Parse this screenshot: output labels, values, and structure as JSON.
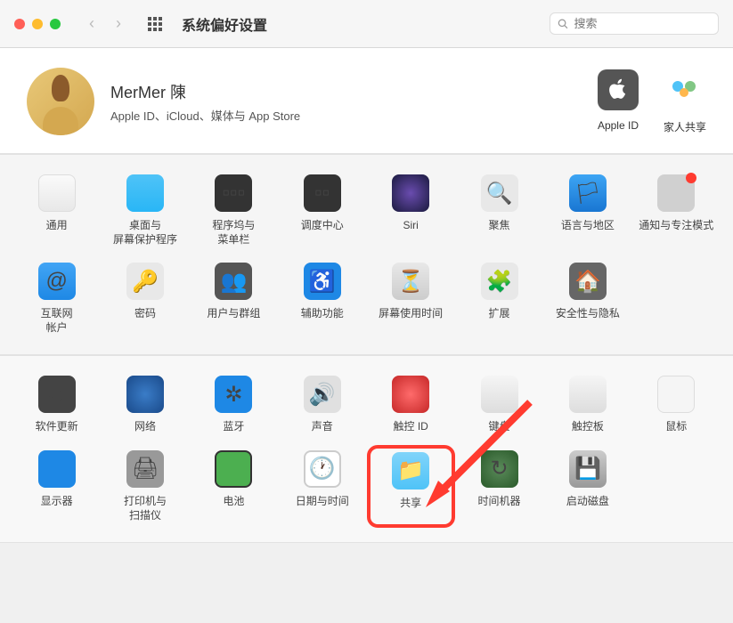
{
  "window": {
    "title": "系统偏好设置",
    "search_placeholder": "搜索"
  },
  "profile": {
    "name": "MerMer 陳",
    "subtitle": "Apple ID、iCloud、媒体与 App Store",
    "apple_id_label": "Apple ID",
    "family_label": "家人共享"
  },
  "section1": [
    {
      "id": "general",
      "label": "通用"
    },
    {
      "id": "desktop",
      "label": "桌面与\n屏幕保护程序"
    },
    {
      "id": "dock",
      "label": "程序坞与\n菜单栏"
    },
    {
      "id": "mission",
      "label": "调度中心"
    },
    {
      "id": "siri",
      "label": "Siri"
    },
    {
      "id": "spotlight",
      "label": "聚焦"
    },
    {
      "id": "language",
      "label": "语言与地区"
    },
    {
      "id": "notifications",
      "label": "通知与专注模式",
      "badge": true
    },
    {
      "id": "internet",
      "label": "互联网\n帐户"
    },
    {
      "id": "passwords",
      "label": "密码"
    },
    {
      "id": "users",
      "label": "用户与群组"
    },
    {
      "id": "accessibility",
      "label": "辅助功能"
    },
    {
      "id": "screentime",
      "label": "屏幕使用时间"
    },
    {
      "id": "extensions",
      "label": "扩展"
    },
    {
      "id": "security",
      "label": "安全性与隐私"
    }
  ],
  "section2": [
    {
      "id": "update",
      "label": "软件更新"
    },
    {
      "id": "network",
      "label": "网络"
    },
    {
      "id": "bluetooth",
      "label": "蓝牙"
    },
    {
      "id": "sound",
      "label": "声音"
    },
    {
      "id": "touchid",
      "label": "触控 ID"
    },
    {
      "id": "keyboard",
      "label": "键盘"
    },
    {
      "id": "trackpad",
      "label": "触控板"
    },
    {
      "id": "mouse",
      "label": "鼠标"
    },
    {
      "id": "displays",
      "label": "显示器"
    },
    {
      "id": "printers",
      "label": "打印机与\n扫描仪"
    },
    {
      "id": "battery",
      "label": "电池"
    },
    {
      "id": "datetime",
      "label": "日期与时间"
    },
    {
      "id": "sharing",
      "label": "共享",
      "highlight": true
    },
    {
      "id": "timemachine",
      "label": "时间机器"
    },
    {
      "id": "startup",
      "label": "启动磁盘"
    }
  ]
}
